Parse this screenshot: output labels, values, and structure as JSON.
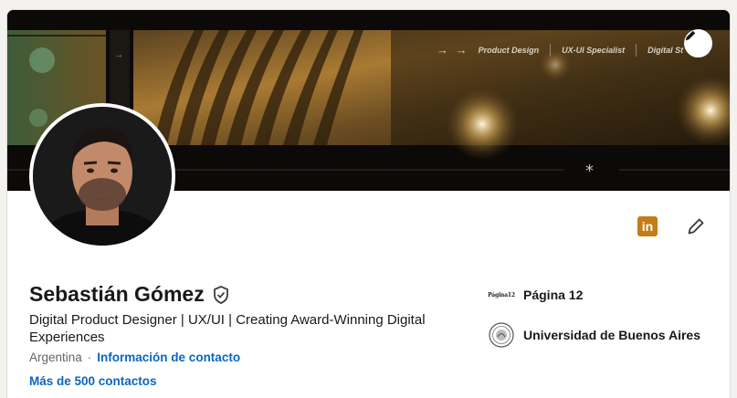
{
  "banner": {
    "nav_items": [
      "Product Design",
      "UX-UI Specialist",
      "Digital St"
    ],
    "arrows": "→ →"
  },
  "profile": {
    "name": "Sebastián Gómez",
    "headline": "Digital Product Designer | UX/UI | Creating Award-Winning Digital Experiences",
    "location": "Argentina",
    "separator": "·",
    "contact_info_label": "Información de contacto",
    "connections_label": "Más de 500 contactos"
  },
  "experience": [
    {
      "name": "Página 12",
      "logo_text": "Página12"
    },
    {
      "name": "Universidad de Buenos Aires"
    }
  ],
  "icons": {
    "verified": "shield-check-icon",
    "edit": "pencil-icon",
    "linkedin": "linkedin-icon"
  },
  "colors": {
    "link": "#0a66c2",
    "linkedin_badge": "#c37d16",
    "banner_bg": "#0b0a08"
  }
}
